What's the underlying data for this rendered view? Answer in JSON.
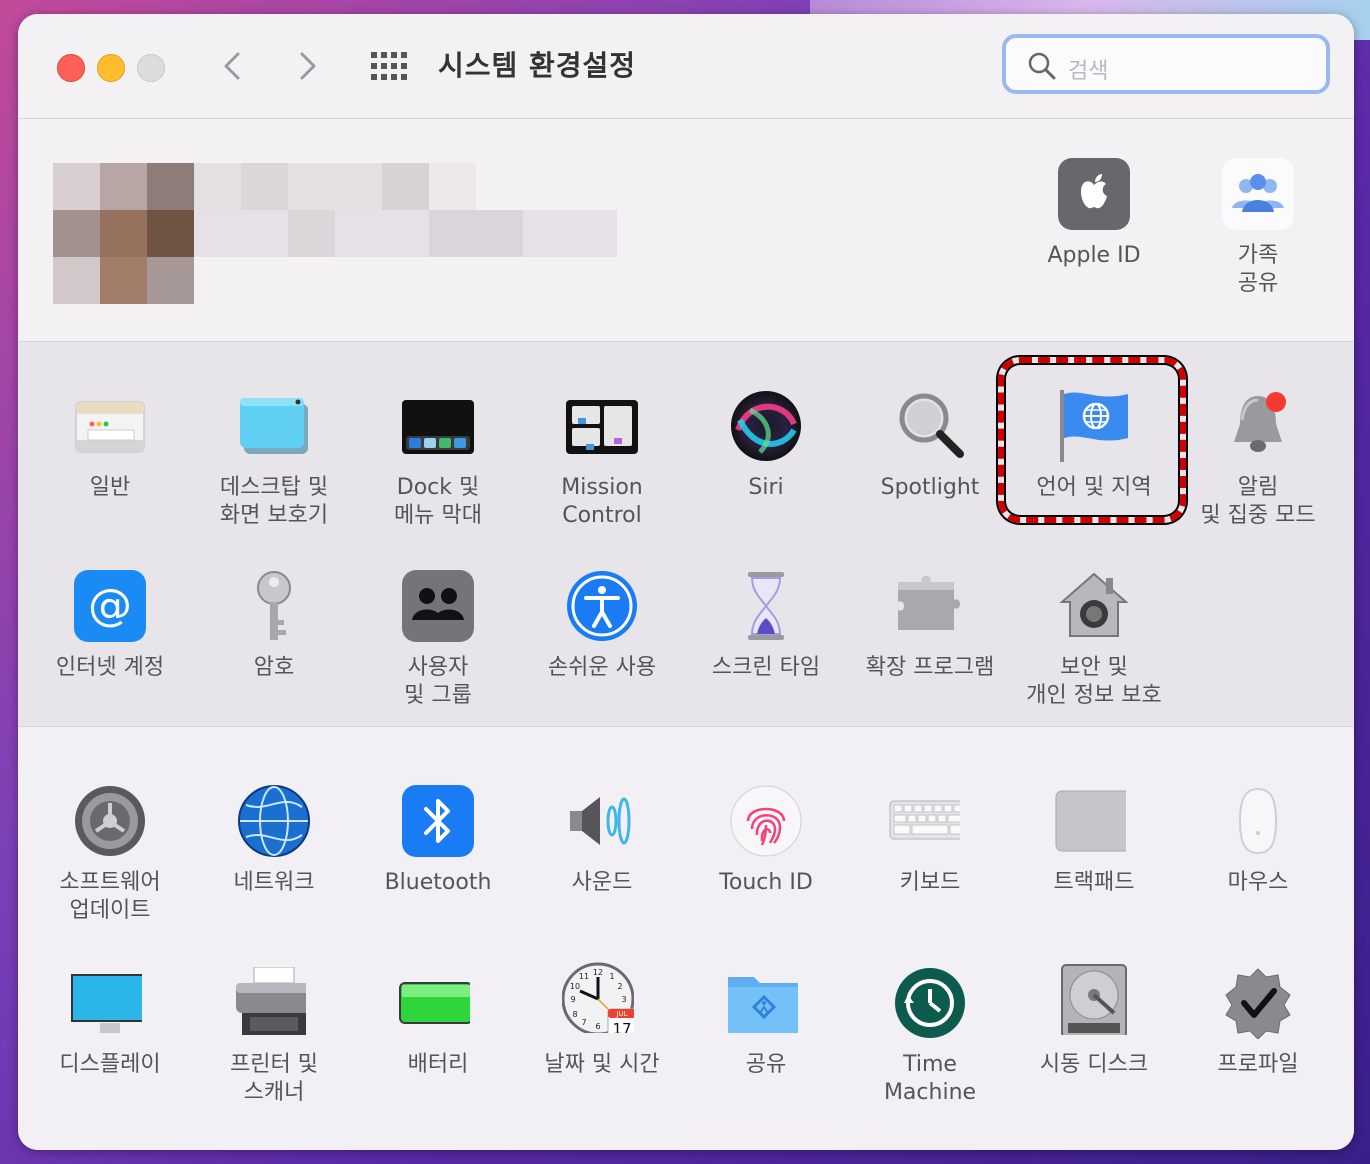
{
  "window": {
    "title": "시스템 환경설정"
  },
  "search": {
    "placeholder": "검색"
  },
  "account": {
    "items": [
      {
        "label": "Apple ID",
        "icon": "apple-id-icon"
      },
      {
        "label": "가족\n공유",
        "icon": "family-sharing-icon"
      }
    ]
  },
  "section1": {
    "items": [
      {
        "label": "일반",
        "icon": "general-icon"
      },
      {
        "label": "데스크탑 및\n화면 보호기",
        "icon": "desktop-screensaver-icon"
      },
      {
        "label": "Dock 및\n메뉴 막대",
        "icon": "dock-icon"
      },
      {
        "label": "Mission\nControl",
        "icon": "mission-control-icon"
      },
      {
        "label": "Siri",
        "icon": "siri-icon"
      },
      {
        "label": "Spotlight",
        "icon": "spotlight-icon"
      },
      {
        "label": "언어 및 지역",
        "icon": "language-region-icon"
      },
      {
        "label": "알림\n및 집중 모드",
        "icon": "notifications-icon"
      },
      {
        "label": "인터넷 계정",
        "icon": "internet-accounts-icon"
      },
      {
        "label": "암호",
        "icon": "passwords-icon"
      },
      {
        "label": "사용자\n및 그룹",
        "icon": "users-groups-icon"
      },
      {
        "label": "손쉬운 사용",
        "icon": "accessibility-icon"
      },
      {
        "label": "스크린 타임",
        "icon": "screen-time-icon"
      },
      {
        "label": "확장 프로그램",
        "icon": "extensions-icon"
      },
      {
        "label": "보안 및\n개인 정보 보호",
        "icon": "security-privacy-icon"
      }
    ]
  },
  "section2": {
    "items": [
      {
        "label": "소프트웨어\n업데이트",
        "icon": "software-update-icon"
      },
      {
        "label": "네트워크",
        "icon": "network-icon"
      },
      {
        "label": "Bluetooth",
        "icon": "bluetooth-icon"
      },
      {
        "label": "사운드",
        "icon": "sound-icon"
      },
      {
        "label": "Touch ID",
        "icon": "touch-id-icon"
      },
      {
        "label": "키보드",
        "icon": "keyboard-icon"
      },
      {
        "label": "트랙패드",
        "icon": "trackpad-icon"
      },
      {
        "label": "마우스",
        "icon": "mouse-icon"
      },
      {
        "label": "디스플레이",
        "icon": "displays-icon"
      },
      {
        "label": "프린터 및\n스캐너",
        "icon": "printers-scanners-icon"
      },
      {
        "label": "배터리",
        "icon": "battery-icon"
      },
      {
        "label": "날짜 및 시간",
        "icon": "date-time-icon"
      },
      {
        "label": "공유",
        "icon": "sharing-icon"
      },
      {
        "label": "Time\nMachine",
        "icon": "time-machine-icon"
      },
      {
        "label": "시동 디스크",
        "icon": "startup-disk-icon"
      },
      {
        "label": "프로파일",
        "icon": "profiles-icon"
      }
    ]
  },
  "calendar": {
    "month": "JUL",
    "day": "17"
  },
  "colors": {
    "highlight": "#d00000",
    "accent": "#1a7cf5",
    "search_border": "#9bb8f0"
  }
}
